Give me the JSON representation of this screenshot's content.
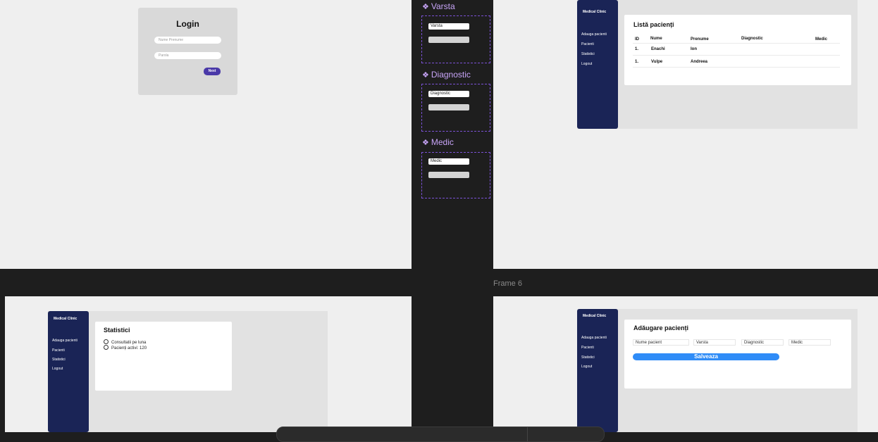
{
  "login": {
    "title": "Login",
    "name_placeholder": "Nume Prenume",
    "password_placeholder": "Parola",
    "next_label": "Next"
  },
  "components": {
    "varsta_title": "Varsta",
    "varsta_input": "Varsta",
    "diagnostic_title": "Diagnostic",
    "diagnostic_input": "Diagnostic",
    "medic_title": "Medic",
    "medic_input": "Medic"
  },
  "canvas": {
    "frame_label": "Frame 6"
  },
  "sidebar": {
    "brand": "Medical Clinic",
    "items": [
      {
        "label": "Adauga pacienti"
      },
      {
        "label": "Pacienti"
      },
      {
        "label": "Statistici"
      },
      {
        "label": "Logout"
      }
    ]
  },
  "patients": {
    "title": "Listă pacienți",
    "headers": [
      "ID",
      "Nume",
      "Prenume",
      "Diagnostic",
      "Medic"
    ],
    "rows": [
      {
        "id": "1.",
        "nume": "Enachi",
        "prenume": "Ion"
      },
      {
        "id": "1.",
        "nume": "Vulpe",
        "prenume": "Andreea"
      }
    ]
  },
  "stats": {
    "title": "Statistici",
    "items": [
      "Consultatii pe luna",
      "Pacienți activi: 120"
    ]
  },
  "add_patient": {
    "title": "Adăugare pacienți",
    "fields": [
      "Nume pacient",
      "Varsta",
      "Diagnostic",
      "Medic"
    ],
    "save_label": "Salveaza"
  }
}
